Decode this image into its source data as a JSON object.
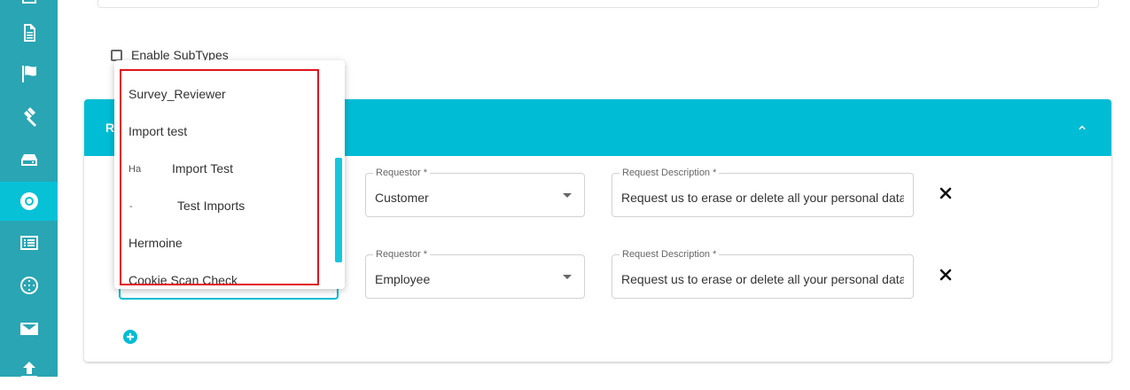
{
  "sidebar": {
    "items": [
      {
        "icon": "inbox-icon"
      },
      {
        "icon": "document-icon"
      },
      {
        "icon": "flag-icon"
      },
      {
        "icon": "gavel-icon"
      },
      {
        "icon": "hard-drive-icon"
      },
      {
        "icon": "lifebuoy-icon",
        "active": true
      },
      {
        "icon": "list-icon"
      },
      {
        "icon": "film-reel-icon"
      },
      {
        "icon": "mail-icon"
      },
      {
        "icon": "upload-icon"
      }
    ]
  },
  "subtypes": {
    "label": "Enable SubTypes",
    "checked": false
  },
  "section": {
    "title_partial": "R"
  },
  "rows": [
    {
      "requestor_label": "Requestor *",
      "requestor_value": "Customer",
      "description_label": "Request Description *",
      "description_value": "Request us to erase or delete all your personal data"
    },
    {
      "requestor_label": "Requestor *",
      "requestor_value": "Employee",
      "description_label": "Request Description *",
      "description_value": "Request us to erase or delete all your personal data"
    }
  ],
  "dropdown": {
    "options": [
      {
        "label": "Survey_Reviewer"
      },
      {
        "label": "Import test"
      },
      {
        "label": "Import Test",
        "prefix_fragment": "Ha"
      },
      {
        "label": "Test Imports",
        "prefix_fragment": "-"
      },
      {
        "label": "Hermoine"
      },
      {
        "label": "Cookie Scan Check"
      }
    ]
  },
  "colors": {
    "sidebar": "#2aa5b3",
    "sidebar_active": "#07c1d7",
    "header": "#00bcd4",
    "highlight": "#e0141c"
  }
}
